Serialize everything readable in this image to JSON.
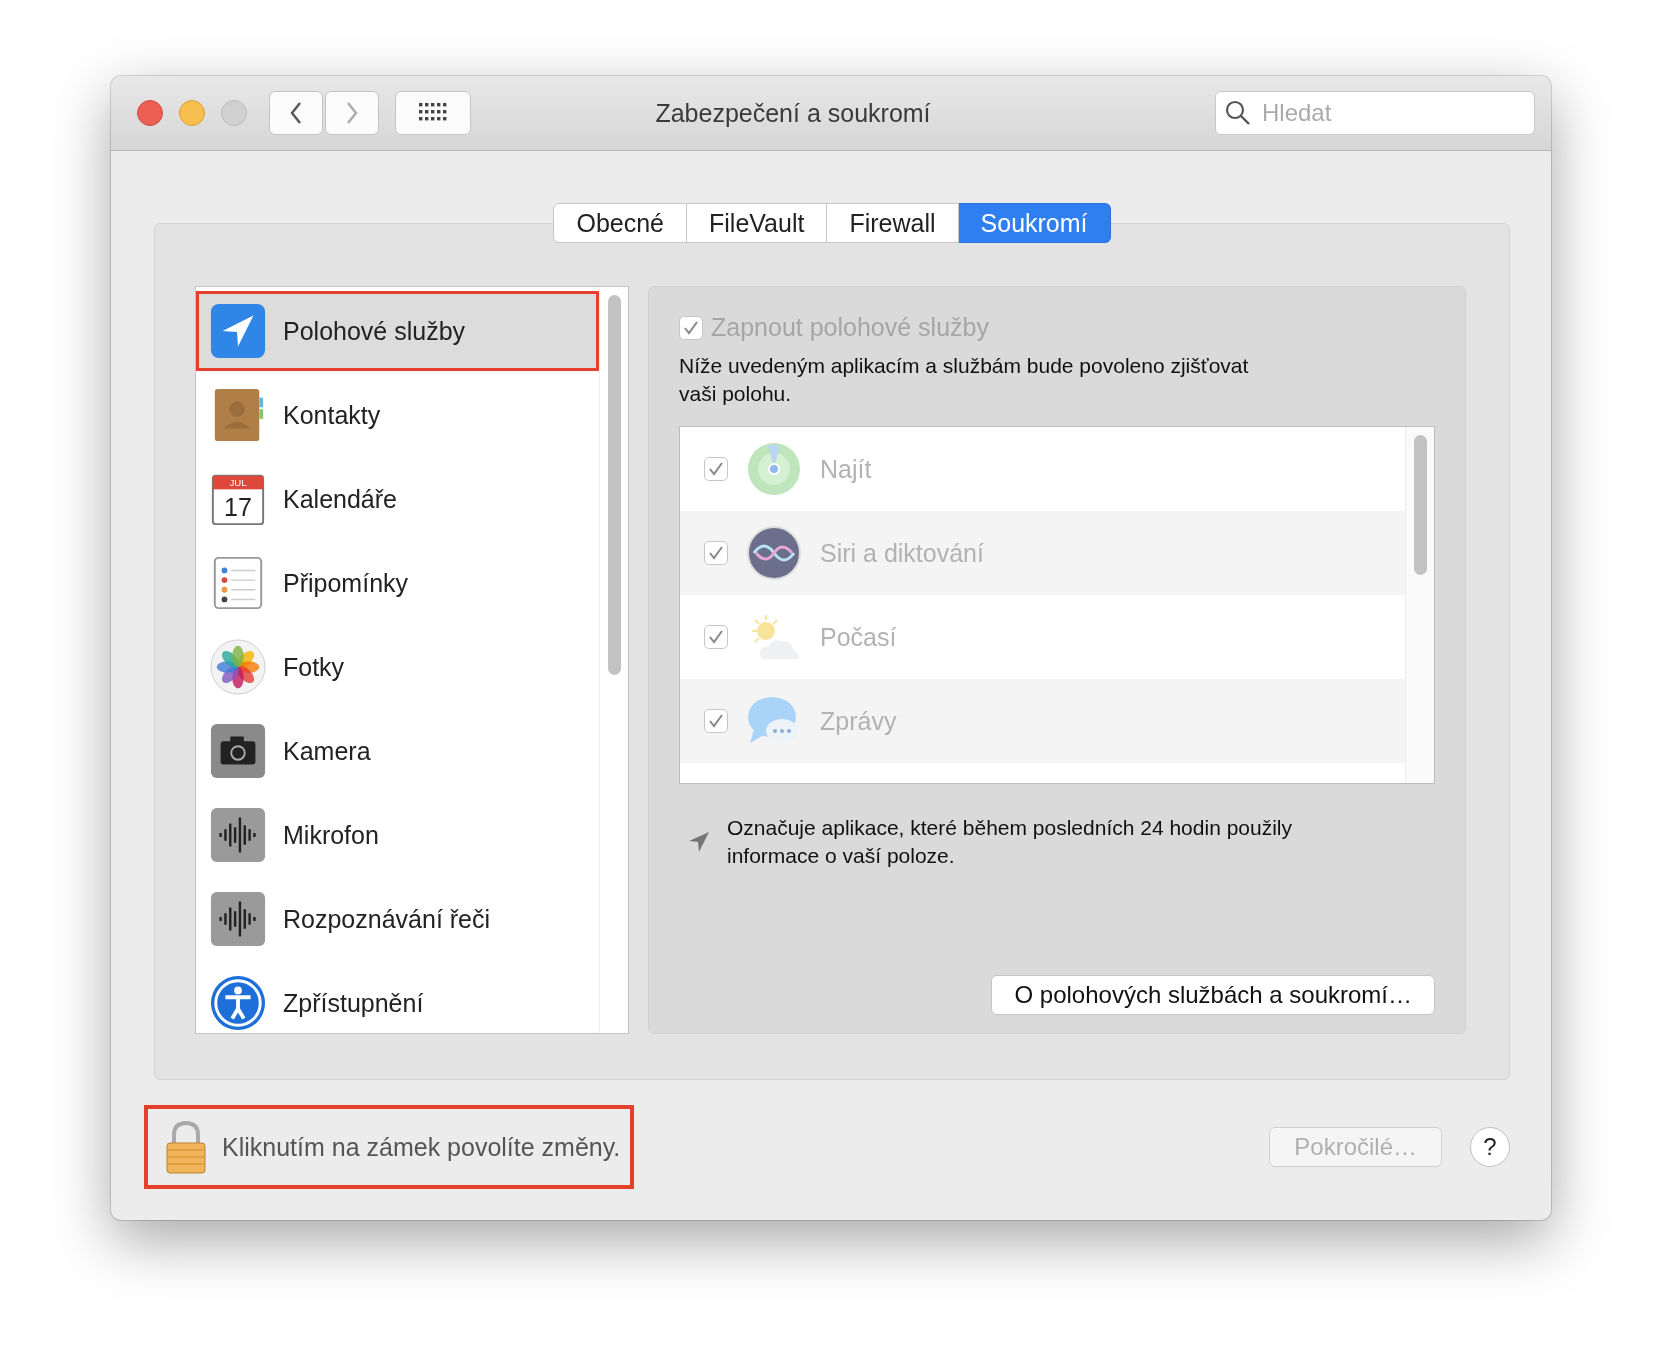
{
  "window": {
    "title": "Zabezpečení a soukromí"
  },
  "search": {
    "placeholder": "Hledat"
  },
  "tabs": [
    {
      "label": "Obecné",
      "selected": false
    },
    {
      "label": "FileVault",
      "selected": false
    },
    {
      "label": "Firewall",
      "selected": false
    },
    {
      "label": "Soukromí",
      "selected": true
    }
  ],
  "sidebar": {
    "items": [
      {
        "label": "Polohové služby",
        "kind": "location",
        "selected": true,
        "highlighted": true
      },
      {
        "label": "Kontakty",
        "kind": "contacts",
        "selected": false,
        "highlighted": false
      },
      {
        "label": "Kalendáře",
        "kind": "calendar",
        "icon_month": "JUL",
        "icon_day": "17",
        "selected": false,
        "highlighted": false
      },
      {
        "label": "Připomínky",
        "kind": "reminders",
        "selected": false,
        "highlighted": false
      },
      {
        "label": "Fotky",
        "kind": "photos",
        "selected": false,
        "highlighted": false
      },
      {
        "label": "Kamera",
        "kind": "camera",
        "selected": false,
        "highlighted": false
      },
      {
        "label": "Mikrofon",
        "kind": "microphone",
        "selected": false,
        "highlighted": false
      },
      {
        "label": "Rozpoznávání řeči",
        "kind": "microphone",
        "selected": false,
        "highlighted": false
      },
      {
        "label": "Zpřístupnění",
        "kind": "accessibility",
        "selected": false,
        "highlighted": false
      }
    ]
  },
  "location_panel": {
    "enable": {
      "label": "Zapnout polohové služby",
      "checked": true,
      "disabled": true
    },
    "description": "Níže uvedeným aplikacím a službám bude povoleno zjišťovat vaši polohu.",
    "apps": [
      {
        "name": "Najít",
        "kind": "find",
        "checked": true
      },
      {
        "name": "Siri a diktování",
        "kind": "siri",
        "checked": true
      },
      {
        "name": "Počasí",
        "kind": "weather",
        "checked": true
      },
      {
        "name": "Zprávy",
        "kind": "messages",
        "checked": true
      }
    ],
    "footnote": "Označuje aplikace, které během posledních 24 hodin použily informace o vaší poloze.",
    "about_button": "O polohových službách a soukromí…"
  },
  "lock": {
    "label": "Kliknutím na zámek povolíte změny.",
    "highlighted": true
  },
  "advanced_button": {
    "label": "Pokročilé…",
    "disabled": true
  },
  "help_button": "?"
}
